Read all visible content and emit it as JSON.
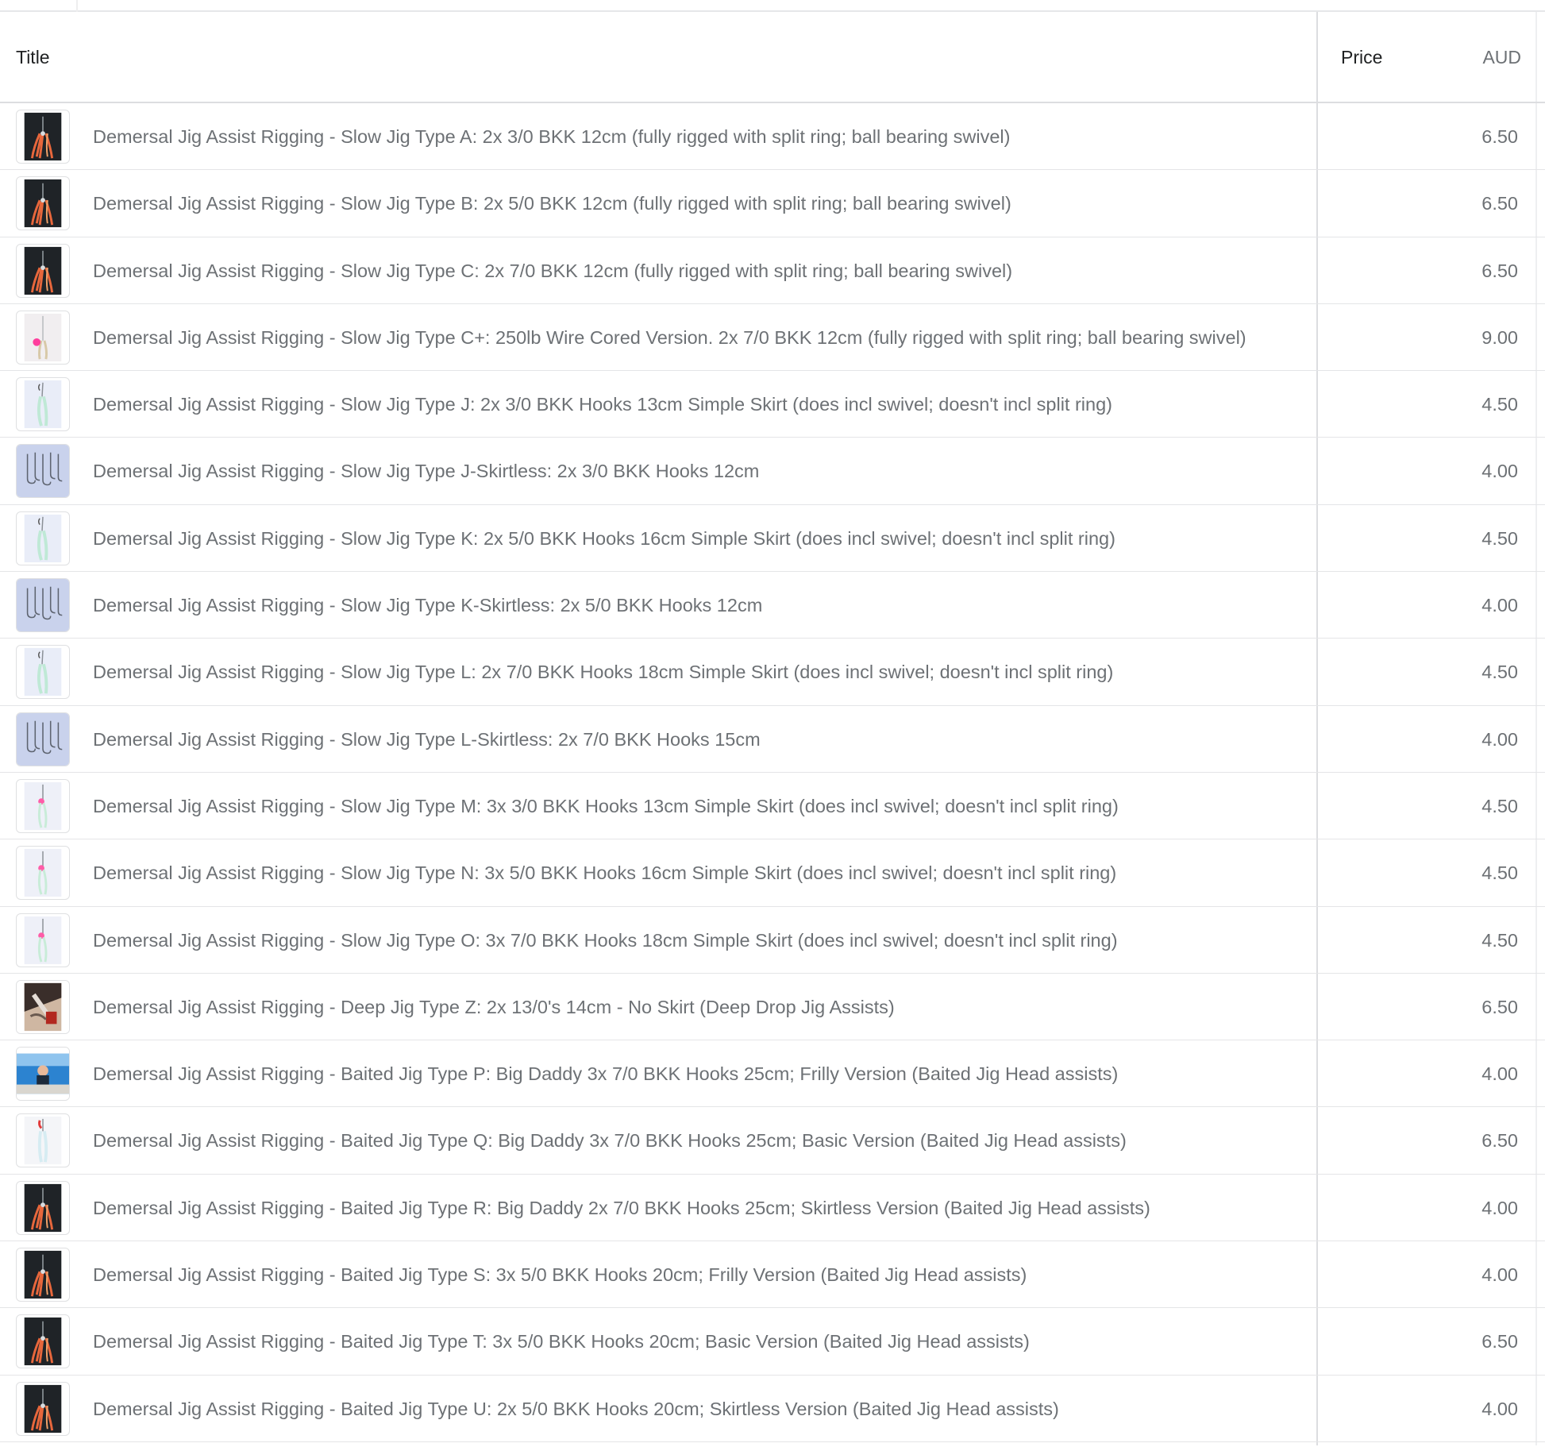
{
  "table": {
    "headers": {
      "title": "Title",
      "price": "Price",
      "currency": "AUD"
    },
    "rows": [
      {
        "title": "Demersal Jig Assist Rigging - Slow Jig Type A: 2x 3/0 BKK 12cm (fully rigged with split ring; ball bearing swivel)",
        "price": "6.50",
        "thumb": "dark-skirt"
      },
      {
        "title": "Demersal Jig Assist Rigging - Slow Jig Type B: 2x 5/0 BKK 12cm (fully rigged with split ring; ball bearing swivel)",
        "price": "6.50",
        "thumb": "dark-skirt"
      },
      {
        "title": "Demersal Jig Assist Rigging - Slow Jig Type C: 2x 7/0 BKK 12cm (fully rigged with split ring; ball bearing swivel)",
        "price": "6.50",
        "thumb": "dark-skirt"
      },
      {
        "title": "Demersal Jig Assist Rigging - Slow Jig Type C+: 250lb Wire Cored Version. 2x 7/0 BKK 12cm (fully rigged with split ring; ball bearing swivel)",
        "price": "9.00",
        "thumb": "pink-wire"
      },
      {
        "title": "Demersal Jig Assist Rigging - Slow Jig Type J: 2x 3/0 BKK Hooks 13cm Simple Skirt (does incl swivel; doesn't incl split ring)",
        "price": "4.50",
        "thumb": "glow-skirt"
      },
      {
        "title": "Demersal Jig Assist Rigging - Slow Jig Type J-Skirtless: 2x 3/0 BKK Hooks 12cm",
        "price": "4.00",
        "thumb": "hooks"
      },
      {
        "title": "Demersal Jig Assist Rigging - Slow Jig Type K: 2x 5/0 BKK Hooks 16cm Simple Skirt (does incl swivel; doesn't incl split ring)",
        "price": "4.50",
        "thumb": "glow-skirt"
      },
      {
        "title": "Demersal Jig Assist Rigging - Slow Jig Type K-Skirtless: 2x 5/0 BKK Hooks 12cm",
        "price": "4.00",
        "thumb": "hooks"
      },
      {
        "title": "Demersal Jig Assist Rigging - Slow Jig Type L: 2x 7/0 BKK Hooks 18cm Simple Skirt (does incl swivel; doesn't incl split ring)",
        "price": "4.50",
        "thumb": "glow-skirt"
      },
      {
        "title": "Demersal Jig Assist Rigging - Slow Jig Type L-Skirtless: 2x 7/0 BKK Hooks 15cm",
        "price": "4.00",
        "thumb": "hooks"
      },
      {
        "title": "Demersal Jig Assist Rigging - Slow Jig Type M: 3x 3/0 BKK Hooks 13cm Simple Skirt (does incl swivel; doesn't incl split ring)",
        "price": "4.50",
        "thumb": "pink-skirt"
      },
      {
        "title": "Demersal Jig Assist Rigging - Slow Jig Type N: 3x 5/0 BKK Hooks 16cm Simple Skirt (does incl swivel; doesn't incl split ring)",
        "price": "4.50",
        "thumb": "pink-skirt"
      },
      {
        "title": "Demersal Jig Assist Rigging - Slow Jig Type O: 3x 7/0 BKK Hooks 18cm Simple Skirt (does incl swivel; doesn't incl split ring)",
        "price": "4.50",
        "thumb": "pink-skirt"
      },
      {
        "title": "Demersal Jig Assist Rigging - Deep Jig Type Z: 2x 13/0's 14cm - No Skirt (Deep Drop Jig Assists)",
        "price": "6.50",
        "thumb": "deep-photo"
      },
      {
        "title": "Demersal Jig Assist Rigging - Baited Jig Type P: Big Daddy 3x 7/0 BKK Hooks 25cm; Frilly Version (Baited Jig Head assists)",
        "price": "4.00",
        "thumb": "boat-photo"
      },
      {
        "title": "Demersal Jig Assist Rigging - Baited Jig Type Q: Big Daddy 3x 7/0 BKK Hooks 25cm; Basic Version (Baited Jig Head assists)",
        "price": "6.50",
        "thumb": "red-skirt"
      },
      {
        "title": "Demersal Jig Assist Rigging - Baited Jig Type R: Big Daddy 2x 7/0 BKK Hooks 25cm; Skirtless Version (Baited Jig Head assists)",
        "price": "4.00",
        "thumb": "dark-skirt"
      },
      {
        "title": "Demersal Jig Assist Rigging - Baited Jig Type S: 3x 5/0 BKK Hooks 20cm; Frilly Version (Baited Jig Head assists)",
        "price": "4.00",
        "thumb": "dark-skirt"
      },
      {
        "title": "Demersal Jig Assist Rigging - Baited Jig Type T: 3x 5/0 BKK Hooks 20cm; Basic Version (Baited Jig Head assists)",
        "price": "6.50",
        "thumb": "dark-skirt"
      },
      {
        "title": "Demersal Jig Assist Rigging - Baited Jig Type U: 2x 5/0 BKK Hooks 20cm; Skirtless Version (Baited Jig Head assists)",
        "price": "4.00",
        "thumb": "dark-skirt"
      }
    ]
  },
  "colors": {
    "header_text": "#202223",
    "row_text": "#6d7175",
    "border": "#dcdde0"
  }
}
